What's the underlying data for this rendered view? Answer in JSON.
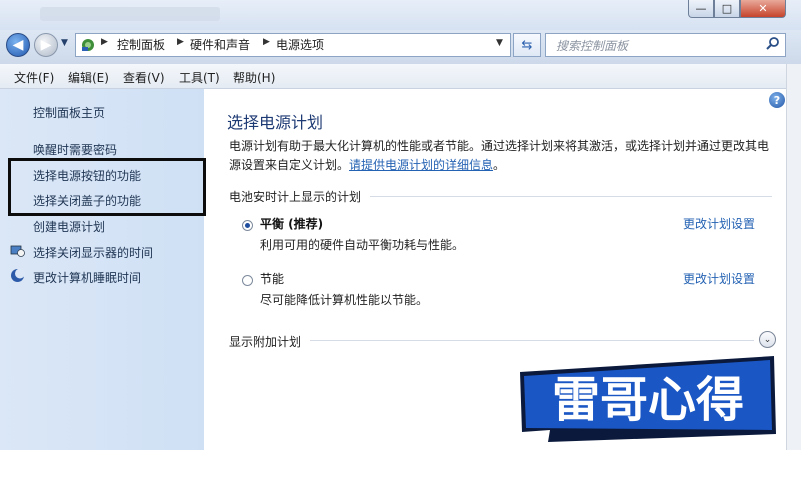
{
  "window": {
    "minimize_glyph": "—",
    "maximize_glyph": "□",
    "close_glyph": "✕"
  },
  "address": {
    "breadcrumbs": [
      "控制面板",
      "硬件和声音",
      "电源选项"
    ],
    "search_placeholder": "搜索控制面板"
  },
  "menu": [
    "文件(F)",
    "编辑(E)",
    "查看(V)",
    "工具(T)",
    "帮助(H)"
  ],
  "sidebar": {
    "items": [
      {
        "label": "控制面板主页",
        "icon": null
      },
      {
        "label": "唤醒时需要密码",
        "icon": null
      },
      {
        "label": "选择电源按钮的功能",
        "icon": null
      },
      {
        "label": "选择关闭盖子的功能",
        "icon": null
      },
      {
        "label": "创建电源计划",
        "icon": null
      },
      {
        "label": "选择关闭显示器的时间",
        "icon": "display-clock-icon"
      },
      {
        "label": "更改计算机睡眠时间",
        "icon": "moon-icon"
      }
    ]
  },
  "main": {
    "title": "选择电源计划",
    "desc_text": "电源计划有助于最大化计算机的性能或者节能。通过选择计划来将其激活，或选择计划并通过更改其电源设置来自定义计划。",
    "desc_link": "请提供电源计划的详细信息",
    "desc_end": "。",
    "section_battery": "电池安时计上显示的计划",
    "plans": [
      {
        "name": "平衡 (推荐)",
        "desc": "利用可用的硬件自动平衡功耗与性能。",
        "link": "更改计划设置",
        "selected": true
      },
      {
        "name": "节能",
        "desc": "尽可能降低计算机性能以节能。",
        "link": "更改计划设置",
        "selected": false
      }
    ],
    "section_more": "显示附加计划",
    "expand_glyph": "⌄"
  },
  "watermark": {
    "text": "雷哥心得",
    "color_dark": "#0b1a3c",
    "color_blue": "#1a56c4"
  },
  "colors": {
    "link": "#2462b3",
    "title": "#1e3a74"
  }
}
